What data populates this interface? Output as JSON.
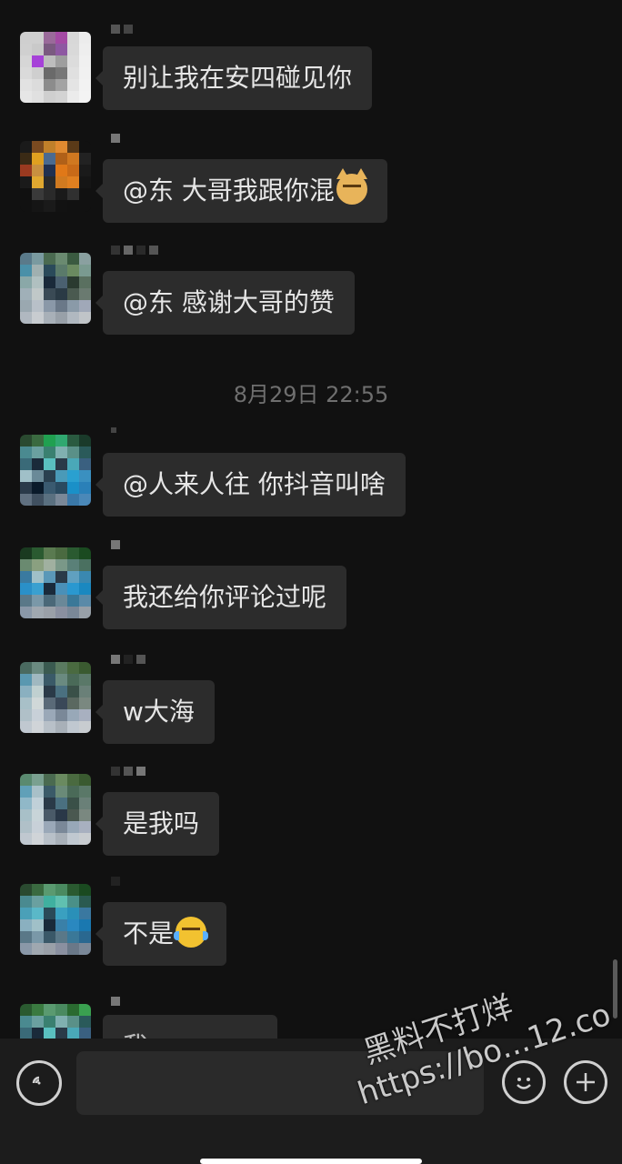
{
  "messages": [
    {
      "id": "m1",
      "text": "别让我在安四碰见你",
      "emoji": null
    },
    {
      "id": "m2",
      "text": "@东 大哥我跟你混",
      "emoji": "cat-face-emoji"
    },
    {
      "id": "m3",
      "text": "@东 感谢大哥的赞",
      "emoji": null
    },
    {
      "id": "m4",
      "text": "@人来人往 你抖音叫啥",
      "emoji": null
    },
    {
      "id": "m5",
      "text": "我还给你评论过呢",
      "emoji": null
    },
    {
      "id": "m6",
      "text": "w大海",
      "emoji": null
    },
    {
      "id": "m7",
      "text": "是我吗",
      "emoji": null
    },
    {
      "id": "m8",
      "text": "不是",
      "emoji": "crying-laughing-emoji"
    },
    {
      "id": "m9",
      "text": "我",
      "emoji": null
    }
  ],
  "timestamp": "8月29日 22:55",
  "input": {
    "placeholder": ""
  },
  "icons": {
    "voice": "voice-icon",
    "emoji": "emoji-icon",
    "plus": "plus-icon"
  },
  "watermark": {
    "line1": "黑料不打烊",
    "line2": "https://bo...12.co"
  }
}
